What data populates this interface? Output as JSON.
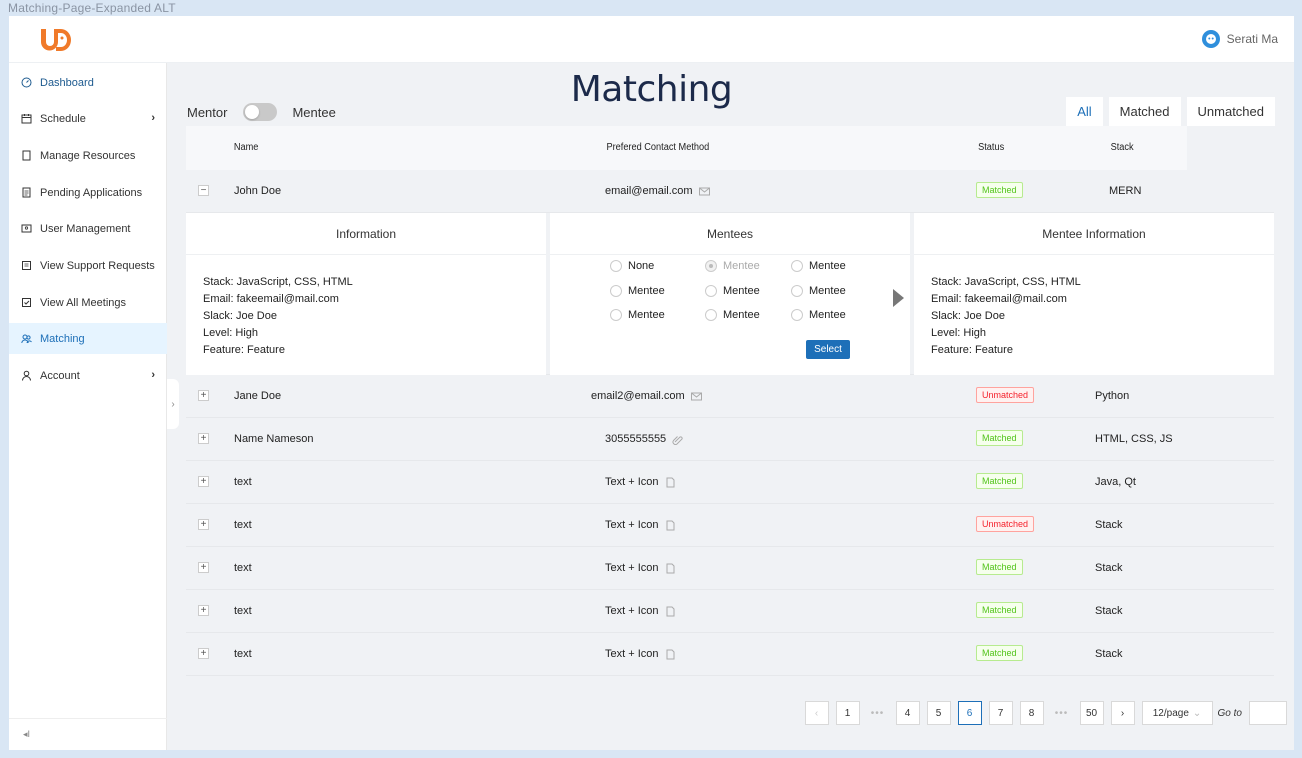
{
  "frame_title": "Matching-Page-Expanded ALT",
  "user": {
    "name": "Serati Ma"
  },
  "sidebar": {
    "items": [
      {
        "label": "Dashboard",
        "icon": "dashboard-icon",
        "active": false
      },
      {
        "label": "Schedule",
        "icon": "calendar-icon",
        "chevron": true
      },
      {
        "label": "Manage Resources",
        "icon": "file-icon"
      },
      {
        "label": "Pending Applications",
        "icon": "document-icon"
      },
      {
        "label": "User Management",
        "icon": "user-card-icon"
      },
      {
        "label": "View Support Requests",
        "icon": "support-icon"
      },
      {
        "label": "View All Meetings",
        "icon": "meetings-icon"
      },
      {
        "label": "Matching",
        "icon": "team-icon",
        "active": true
      },
      {
        "label": "Account",
        "icon": "account-icon",
        "chevron": true
      }
    ]
  },
  "page": {
    "title": "Matching"
  },
  "role_toggle": {
    "left": "Mentor",
    "right": "Mentee"
  },
  "filters": {
    "all": "All",
    "matched": "Matched",
    "unmatched": "Unmatched"
  },
  "table": {
    "headers": {
      "name": "Name",
      "contact": "Prefered Contact Method",
      "status": "Status",
      "stack": "Stack"
    },
    "expanded_row": {
      "name": "John Doe",
      "contact": "email@email.com",
      "status": "Matched",
      "stack": "MERN"
    },
    "rows": [
      {
        "name": "Jane Doe",
        "contact": "email2@email.com",
        "status": "Unmatched",
        "stack": "Python"
      },
      {
        "name": "Name Nameson",
        "contact": "3055555555",
        "status": "Matched",
        "stack": "HTML, CSS, JS"
      },
      {
        "name": "text",
        "contact": "Text + Icon",
        "status": "Matched",
        "stack": "Java, Qt"
      },
      {
        "name": "text",
        "contact": "Text + Icon",
        "status": "Unmatched",
        "stack": "Stack"
      },
      {
        "name": "text",
        "contact": "Text + Icon",
        "status": "Matched",
        "stack": "Stack"
      },
      {
        "name": "text",
        "contact": "Text + Icon",
        "status": "Matched",
        "stack": "Stack"
      },
      {
        "name": "text",
        "contact": "Text + Icon",
        "status": "Matched",
        "stack": "Stack"
      }
    ]
  },
  "details": {
    "information": {
      "title": "Information",
      "lines": [
        "Stack: JavaScript, CSS, HTML",
        "Email: fakeemail@mail.com",
        "Slack: Joe Doe",
        "Level: High",
        "Feature: Feature"
      ]
    },
    "mentees": {
      "title": "Mentees",
      "options": [
        "None",
        "Mentee",
        "Mentee",
        "Mentee",
        "Mentee",
        "Mentee",
        "Mentee",
        "Mentee",
        "Mentee"
      ],
      "select_label": "Select"
    },
    "mentee_information": {
      "title": "Mentee Information",
      "lines": [
        "Stack: JavaScript, CSS, HTML",
        "Email: fakeemail@mail.com",
        "Slack: Joe Doe",
        "Level: High",
        "Feature: Feature"
      ]
    }
  },
  "pagination": {
    "pages": [
      "1",
      "4",
      "5",
      "6",
      "7",
      "8",
      "50"
    ],
    "current": "6",
    "per_page": "12/page",
    "goto_label": "Go to"
  },
  "colors": {
    "accent": "#1d6fb8",
    "matched": "#52c41a",
    "unmatched": "#f5222d",
    "logo": "#f07a2a"
  }
}
